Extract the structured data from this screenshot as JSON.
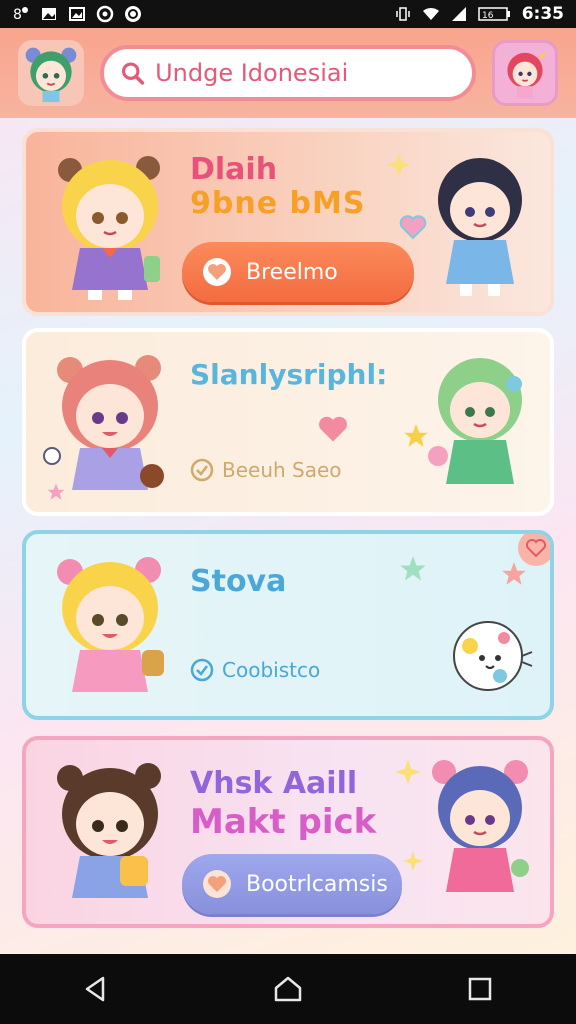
{
  "status_bar": {
    "time": "6:35",
    "battery_level": "16",
    "icons": [
      "notification-icon",
      "image-icon",
      "gallery-icon",
      "sync-icon",
      "circle-app-icon",
      "vibrate-icon",
      "wifi-icon",
      "signal-icon",
      "battery-icon"
    ]
  },
  "header": {
    "search_text": "Undge Idonesiai",
    "left_avatar": "green-hair-avatar",
    "right_avatar": "pink-hair-avatar"
  },
  "cards": [
    {
      "title_line1": "Dlaih",
      "title_line2": "9bne bMS",
      "button_label": "Breelmo",
      "button_icon": "heart-icon",
      "accent": "#f36c3f"
    },
    {
      "title": "Slanlysriphl:",
      "check_label": "Beeuh Saeo",
      "check_icon": "check-icon",
      "accent": "#58b6dd"
    },
    {
      "title": "Stova",
      "check_label": "Coobistco",
      "check_icon": "check-icon",
      "accent": "#4aa7d8"
    },
    {
      "title_line1": "Vhsk Aaill",
      "title_line2": "Makt pick",
      "button_label": "Bootrlcamsis",
      "button_icon": "heart-icon",
      "accent": "#8890dc"
    }
  ],
  "nav_bar": {
    "back": "back-icon",
    "home": "home-icon",
    "recents": "recents-icon"
  }
}
